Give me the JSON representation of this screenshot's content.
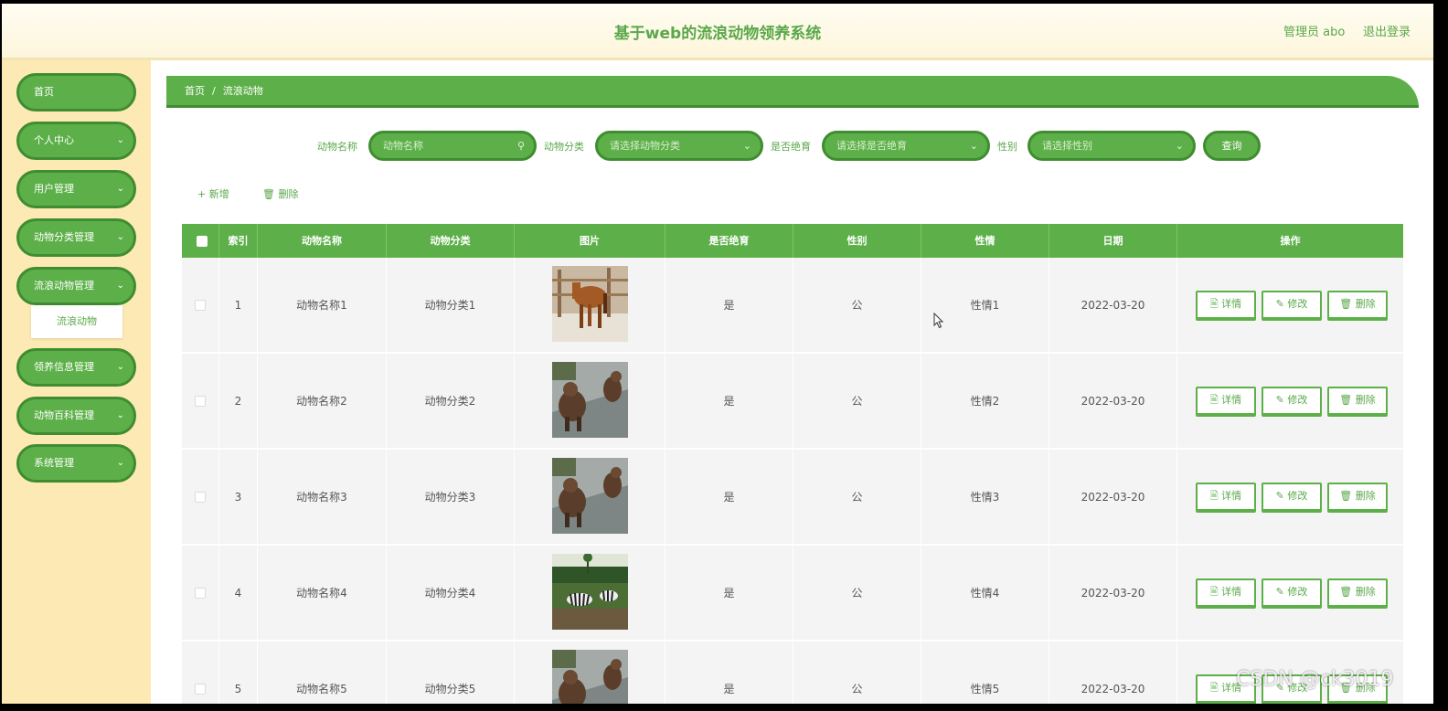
{
  "header": {
    "title": "基于web的流浪动物领养系统",
    "admin": "管理员 abo",
    "logout": "退出登录"
  },
  "sidebar": {
    "items": [
      {
        "label": "首页"
      },
      {
        "label": "个人中心"
      },
      {
        "label": "用户管理"
      },
      {
        "label": "动物分类管理"
      },
      {
        "label": "流浪动物管理"
      },
      {
        "label": "领养信息管理"
      },
      {
        "label": "动物百科管理"
      },
      {
        "label": "系统管理"
      }
    ],
    "submenu": "流浪动物"
  },
  "breadcrumb": {
    "home": "首页",
    "sep": "/",
    "current": "流浪动物"
  },
  "search": {
    "name_label": "动物名称",
    "name_placeholder": "动物名称",
    "category_label": "动物分类",
    "category_placeholder": "请选择动物分类",
    "neutered_label": "是否绝育",
    "neutered_placeholder": "请选择是否绝育",
    "gender_label": "性别",
    "gender_placeholder": "请选择性别",
    "query": "查询"
  },
  "actions": {
    "add": "新增",
    "delete": "删除"
  },
  "table": {
    "headers": [
      "索引",
      "动物名称",
      "动物分类",
      "图片",
      "是否绝育",
      "性别",
      "性情",
      "日期",
      "操作"
    ],
    "rows": [
      {
        "index": "1",
        "name": "动物名称1",
        "category": "动物分类1",
        "photo": "horse",
        "neutered": "是",
        "gender": "公",
        "temper": "性情1",
        "date": "2022-03-20"
      },
      {
        "index": "2",
        "name": "动物名称2",
        "category": "动物分类2",
        "photo": "bears",
        "neutered": "是",
        "gender": "公",
        "temper": "性情2",
        "date": "2022-03-20"
      },
      {
        "index": "3",
        "name": "动物名称3",
        "category": "动物分类3",
        "photo": "bears",
        "neutered": "是",
        "gender": "公",
        "temper": "性情3",
        "date": "2022-03-20"
      },
      {
        "index": "4",
        "name": "动物名称4",
        "category": "动物分类4",
        "photo": "zebras",
        "neutered": "是",
        "gender": "公",
        "temper": "性情4",
        "date": "2022-03-20"
      },
      {
        "index": "5",
        "name": "动物名称5",
        "category": "动物分类5",
        "photo": "bears",
        "neutered": "是",
        "gender": "公",
        "temper": "性情5",
        "date": "2022-03-20"
      }
    ],
    "row_buttons": {
      "detail": "详情",
      "edit": "修改",
      "delete": "删除"
    }
  },
  "colors": {
    "primary": "#5db049",
    "primary_dark": "#3f8d30",
    "sidebar_bg": "#fde9b4",
    "text_green": "#5aa84a"
  },
  "watermark": "CSDN @ck3019"
}
